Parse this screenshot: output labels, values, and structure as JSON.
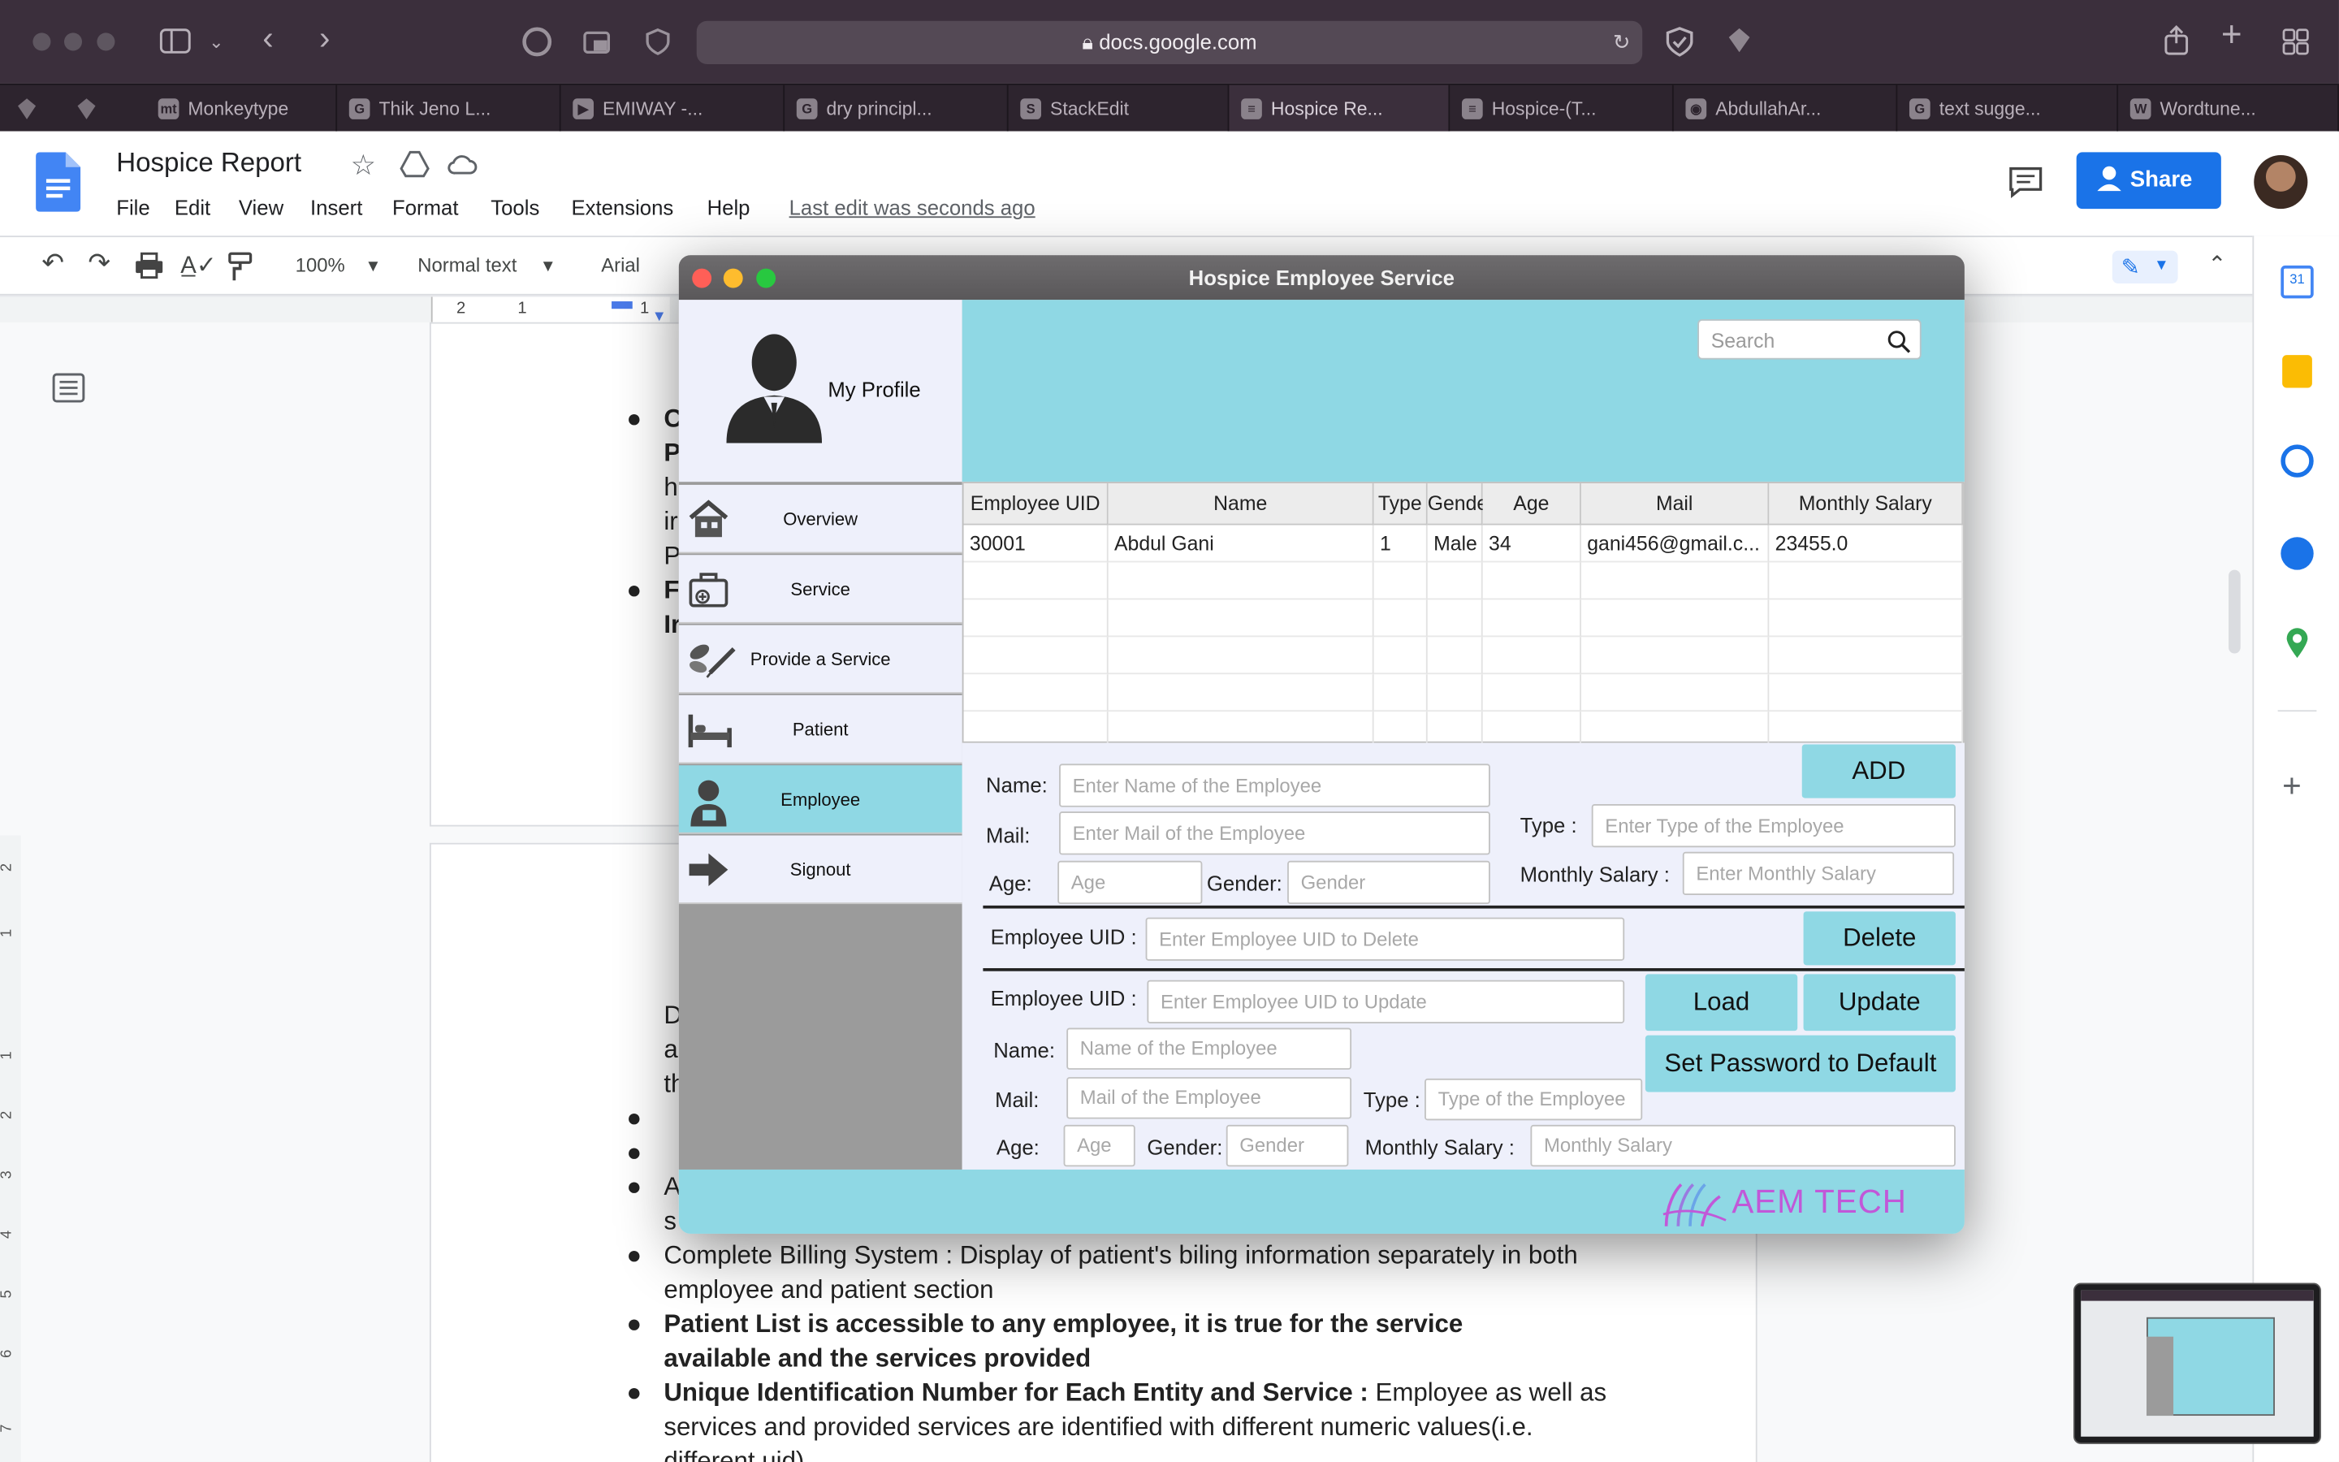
{
  "browser": {
    "url": "docs.google.com",
    "tabs": [
      {
        "label": "Monkeytype",
        "fav": "mt"
      },
      {
        "label": "Thik Jeno L...",
        "fav": "G"
      },
      {
        "label": "EMIWAY -...",
        "fav": "▶"
      },
      {
        "label": "dry principl...",
        "fav": "G"
      },
      {
        "label": "StackEdit",
        "fav": "S"
      },
      {
        "label": "Hospice Re...",
        "fav": "≡"
      },
      {
        "label": "Hospice-(T...",
        "fav": "≡"
      },
      {
        "label": "AbdullahAr...",
        "fav": "◉"
      },
      {
        "label": "text sugge...",
        "fav": "G"
      },
      {
        "label": "Wordtune...",
        "fav": "W"
      }
    ]
  },
  "docs": {
    "title": "Hospice Report",
    "menus": [
      "File",
      "Edit",
      "View",
      "Insert",
      "Format",
      "Tools",
      "Extensions",
      "Help"
    ],
    "last_edit": "Last edit was seconds ago",
    "share_label": "Share",
    "zoom": "100%",
    "style": "Normal text",
    "font": "Arial",
    "ruler_marks": [
      "2",
      "1",
      "1"
    ],
    "page_text": {
      "b1_frag": [
        "C",
        "P",
        "h",
        "ir",
        "P"
      ],
      "b2_frag": [
        "F",
        "Ir"
      ],
      "d_frag": [
        "D",
        "a",
        "th"
      ],
      "a_frag": [
        "A",
        "s"
      ],
      "billing": "Complete Billing System : Display of patient's biling information separately in both employee and patient section",
      "patient_list": "Patient List is accessible to any employee, it is true for the service available and the services provided",
      "uid_bold": "Unique Identification Number for Each Entity and Service :",
      "uid_rest": " Employee as well as services and provided services are identified with different numeric values(i.e. different uid)"
    },
    "left_ruler": [
      "2",
      "1",
      "1",
      "2",
      "3",
      "4",
      "5",
      "6",
      "7"
    ]
  },
  "app": {
    "window_title": "Hospice Employee Service",
    "profile_label": "My Profile",
    "search_placeholder": "Search",
    "nav": [
      {
        "label": "Overview",
        "icon": "house-icon"
      },
      {
        "label": "Service",
        "icon": "medical-kit-icon"
      },
      {
        "label": "Provide a Service",
        "icon": "pills-syringe-icon"
      },
      {
        "label": "Patient",
        "icon": "bed-icon"
      },
      {
        "label": "Employee",
        "icon": "employee-icon"
      },
      {
        "label": "Signout",
        "icon": "arrow-right-icon"
      }
    ],
    "active_nav": "Employee",
    "table": {
      "headers": [
        "Employee UID",
        "Name",
        "Type",
        "Gender",
        "Age",
        "Mail",
        "Monthly Salary"
      ],
      "rows": [
        [
          "30001",
          "Abdul Gani",
          "1",
          "Male",
          "34",
          "gani456@gmail.c...",
          "23455.0"
        ]
      ]
    },
    "add_form": {
      "name_label": "Name:",
      "name_placeholder": "Enter Name of the Employee",
      "mail_label": "Mail:",
      "mail_placeholder": "Enter Mail of the Employee",
      "age_label": "Age:",
      "age_placeholder": "Age",
      "gender_label": "Gender:",
      "gender_placeholder": "Gender",
      "type_label": "Type :",
      "type_placeholder": "Enter Type of the Employee",
      "salary_label": "Monthly Salary :",
      "salary_placeholder": "Enter Monthly Salary",
      "add_button": "ADD"
    },
    "delete_form": {
      "uid_label": "Employee UID :",
      "uid_placeholder": "Enter Employee UID to Delete",
      "delete_button": "Delete"
    },
    "update_form": {
      "uid_label": "Employee UID :",
      "uid_placeholder": "Enter Employee UID to Update",
      "load_button": "Load",
      "update_button": "Update",
      "reset_button": "Set Password to Default",
      "name_label": "Name:",
      "name_placeholder": "Name of the Employee",
      "mail_label": "Mail:",
      "mail_placeholder": "Mail of the Employee",
      "type_label": "Type :",
      "type_placeholder": "Type of the Employee",
      "age_label": "Age:",
      "age_placeholder": "Age",
      "gender_label": "Gender:",
      "gender_placeholder": "Gender",
      "salary_label": "Monthly Salary :",
      "salary_placeholder": "Monthly Salary"
    },
    "brand": "AEM TECH",
    "colors": {
      "accent": "#8fd8e4",
      "panel": "#eef0fb",
      "brand": "#c158d8"
    }
  }
}
